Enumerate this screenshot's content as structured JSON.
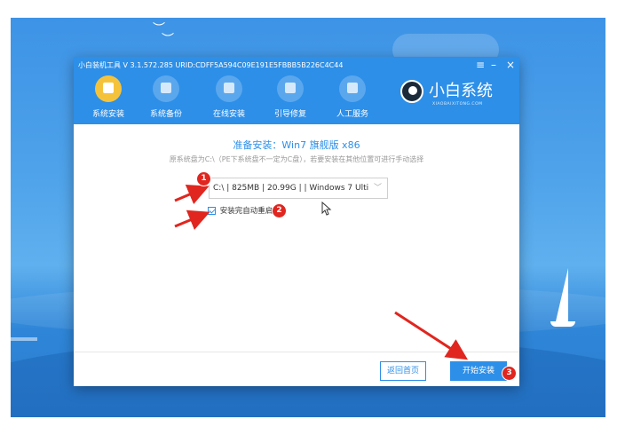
{
  "window": {
    "title": "小白装机工具 V 3.1.572.285 URID:CDFF5A594C09E191E5FBBB5B226C4C44",
    "menu_icon": "≡",
    "minimize_icon": "–",
    "close_icon": "×"
  },
  "nav": {
    "items": [
      {
        "label": "系统安装",
        "icon": "system-install-icon"
      },
      {
        "label": "系统备份",
        "icon": "backup-icon"
      },
      {
        "label": "在线安装",
        "icon": "online-install-icon"
      },
      {
        "label": "引导修复",
        "icon": "boot-repair-icon"
      },
      {
        "label": "人工服务",
        "icon": "chat-icon"
      }
    ]
  },
  "brand": {
    "name": "小白系统",
    "sub": "XIAOBAIXITONG.COM"
  },
  "content": {
    "title": "准备安装：Win7 旗舰版 x86",
    "desc": "原系统盘为C:\\（PE下系统盘不一定为C盘），若要安装在其他位置可进行手动选择",
    "disk_select_value": "C:\\ | 825MB | 20.99G | | Windows 7 Ulti",
    "auto_restart_label": "安装完自动重启",
    "auto_restart_checked": true
  },
  "footer": {
    "back_label": "返回首页",
    "start_label": "开始安装"
  },
  "annotations": {
    "marker_1": "1",
    "marker_2": "2",
    "marker_3": "3",
    "arrow_color": "#e0261f"
  }
}
